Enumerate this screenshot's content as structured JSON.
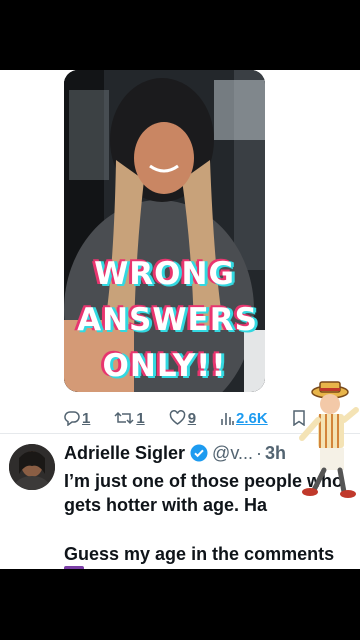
{
  "media": {
    "overlay_lines": [
      "WRONG",
      "ANSWERS",
      "ONLY!!"
    ]
  },
  "actions": {
    "replies": "1",
    "reposts": "1",
    "likes": "9",
    "views": "2.6K"
  },
  "post": {
    "author_name": "Adrielle Sigler",
    "handle": "@v...",
    "separator": "·",
    "time": "3h",
    "text": "I’m just one of those people who gets hotter with age. Ha",
    "text2": "Guess my age in the comments"
  },
  "colors": {
    "accent": "#1d9bf0",
    "overlay_pink": "#e8356f",
    "overlay_cyan": "#33d8e0"
  },
  "icons": [
    "reply-icon",
    "repost-icon",
    "like-icon",
    "views-icon",
    "bookmark-icon",
    "verified-badge-icon"
  ]
}
